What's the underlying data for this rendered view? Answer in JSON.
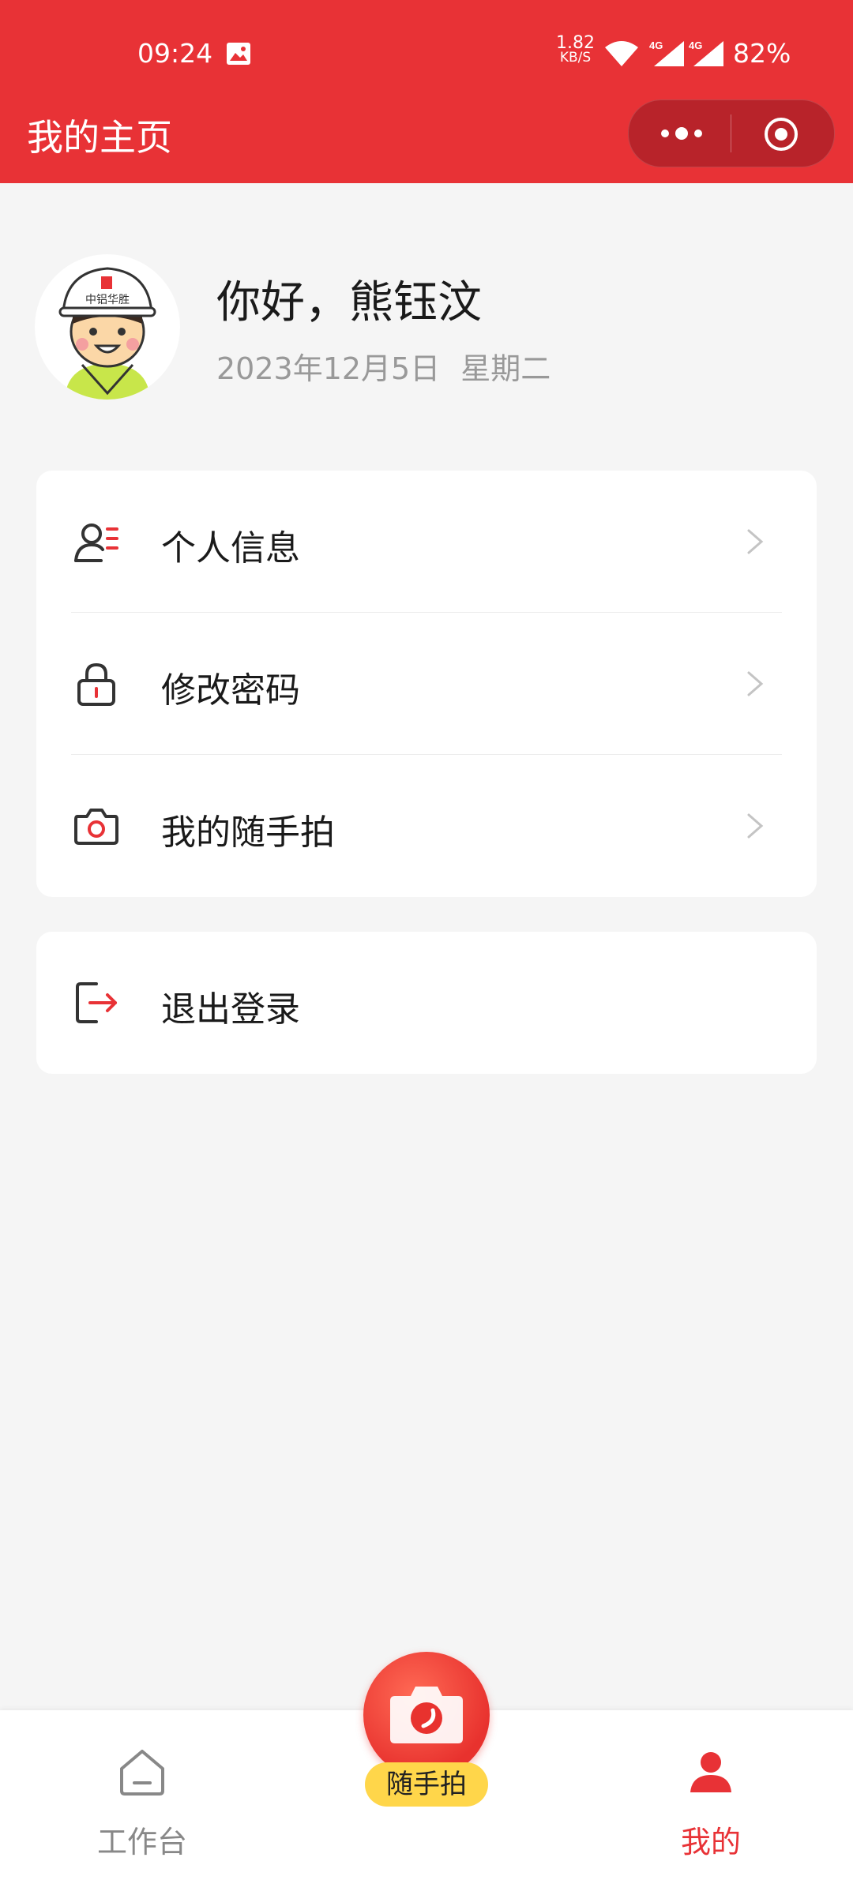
{
  "status_bar": {
    "time": "09:24",
    "net_speed_value": "1.82",
    "net_speed_unit": "KB/S",
    "network_type_1": "4G",
    "network_type_2": "4G",
    "battery": "82%"
  },
  "header": {
    "title": "我的主页",
    "bg_color": "#e83236"
  },
  "profile": {
    "greeting": "你好，熊钰汶",
    "date": "2023年12月5日",
    "weekday": "星期二",
    "avatar_badge_text": "中铝华胜"
  },
  "menu": {
    "items": [
      {
        "label": "个人信息",
        "icon": "user-info-icon"
      },
      {
        "label": "修改密码",
        "icon": "lock-icon"
      },
      {
        "label": "我的随手拍",
        "icon": "camera-icon"
      }
    ],
    "logout": {
      "label": "退出登录",
      "icon": "logout-icon"
    }
  },
  "tabbar": {
    "work": "工作台",
    "center": "随手拍",
    "mine": "我的",
    "active": "我的",
    "accent_color": "#e83236"
  }
}
